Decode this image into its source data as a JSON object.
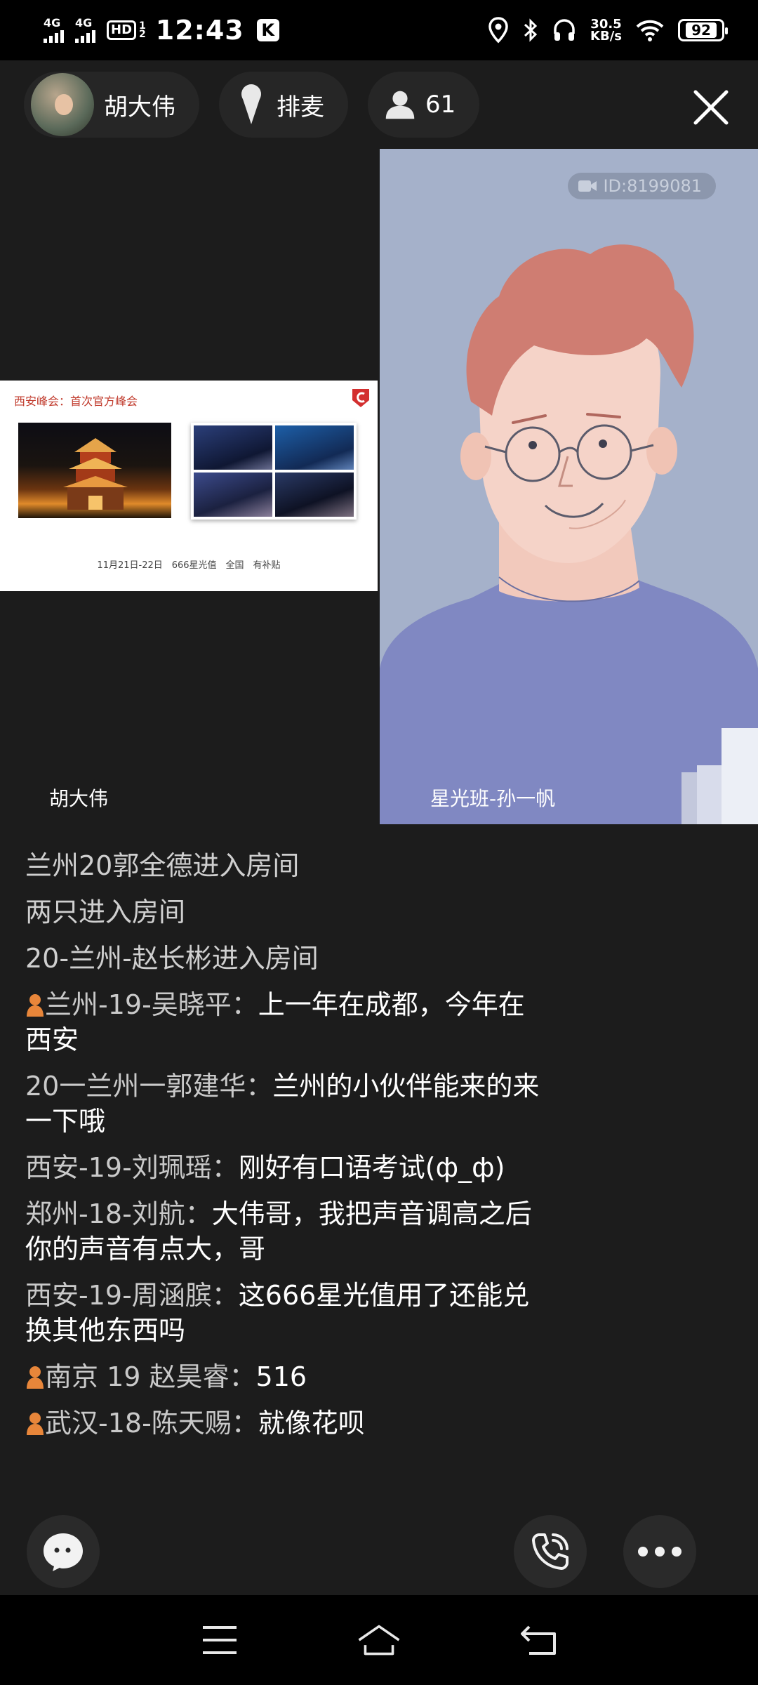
{
  "status_bar": {
    "network_1": "4G",
    "network_2": "4G",
    "hd_label": "HD",
    "hd_sub_1": "1",
    "hd_sub_2": "2",
    "time": "12:43",
    "k_badge": "K",
    "speed_value": "30.5",
    "speed_unit": "KB/s",
    "battery": "92"
  },
  "room": {
    "host_name": "胡大伟",
    "queue_label": "排麦",
    "viewer_count": "61"
  },
  "left_video": {
    "slide_title": "西安峰会：首次官方峰会",
    "slide_caption": "11月21日-22日　666星光值　全国　有补贴",
    "name": "胡大伟"
  },
  "right_video": {
    "id_label": "ID:8199081",
    "name": "星光班-孙一帆"
  },
  "chat": [
    {
      "sys": true,
      "text": "兰州20郭全德进入房间"
    },
    {
      "sys": true,
      "text": "两只进入房间"
    },
    {
      "sys": true,
      "text": "20-兰州-赵长彬进入房间"
    },
    {
      "icon": true,
      "user": "兰州-19-吴晓平：",
      "text": "上一年在成都，今年在西安"
    },
    {
      "icon": false,
      "user": "20一兰州一郭建华：",
      "text": "兰州的小伙伴能来的来一下哦"
    },
    {
      "icon": false,
      "user": "西安-19-刘珮瑶：",
      "text": "刚好有口语考试(ф_ф)"
    },
    {
      "icon": false,
      "user": "郑州-18-刘航：",
      "text": "大伟哥，我把声音调高之后你的声音有点大，哥"
    },
    {
      "icon": false,
      "user": "西安-19-周涵膑：",
      "text": "这666星光值用了还能兑换其他东西吗"
    },
    {
      "icon": true,
      "user": "南京 19 赵昊睿：",
      "text": "516"
    },
    {
      "icon": true,
      "user": "武汉-18-陈天赐：",
      "text": "就像花呗"
    }
  ],
  "colors": {
    "background": "#1c1c1c",
    "pill": "#262626",
    "video_bg": "#a7b3cc",
    "user_icon": "#e8863a"
  }
}
